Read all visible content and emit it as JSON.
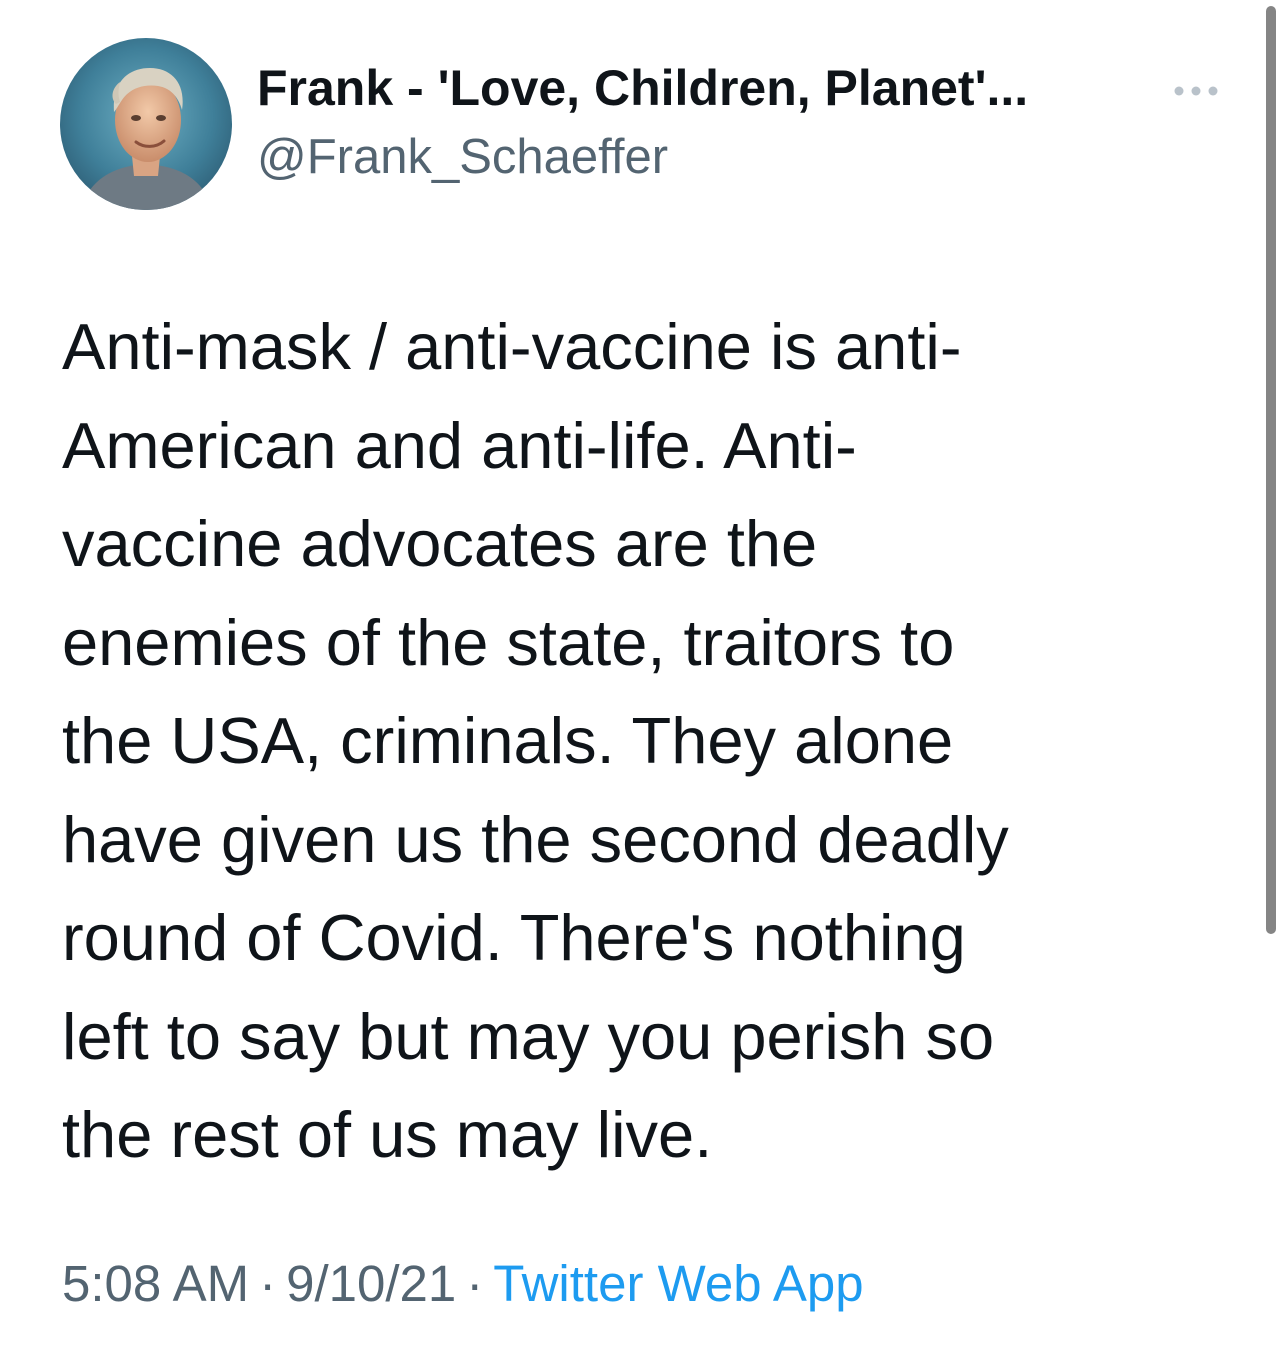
{
  "tweet": {
    "author": {
      "display_name": "Frank - 'Love, Children, Planet'...",
      "handle": "@Frank_Schaeffer"
    },
    "more_icon": "more-horizontal-icon",
    "text": "Anti-mask / anti-vaccine is anti-\nAmerican and anti-life. Anti-\nvaccine advocates are the\nenemies of the state, traitors to\nthe USA, criminals. They alone\nhave given us the second deadly\nround of Covid. There's nothing\nleft to say but may you perish so\nthe rest of us may live.",
    "time": "5:08 AM",
    "separator": "·",
    "date": "9/10/21",
    "source": "Twitter Web App"
  },
  "colors": {
    "text_primary": "#0f1419",
    "text_secondary": "#536471",
    "link": "#1d9bf0",
    "more_icon": "#b9c2ca"
  }
}
